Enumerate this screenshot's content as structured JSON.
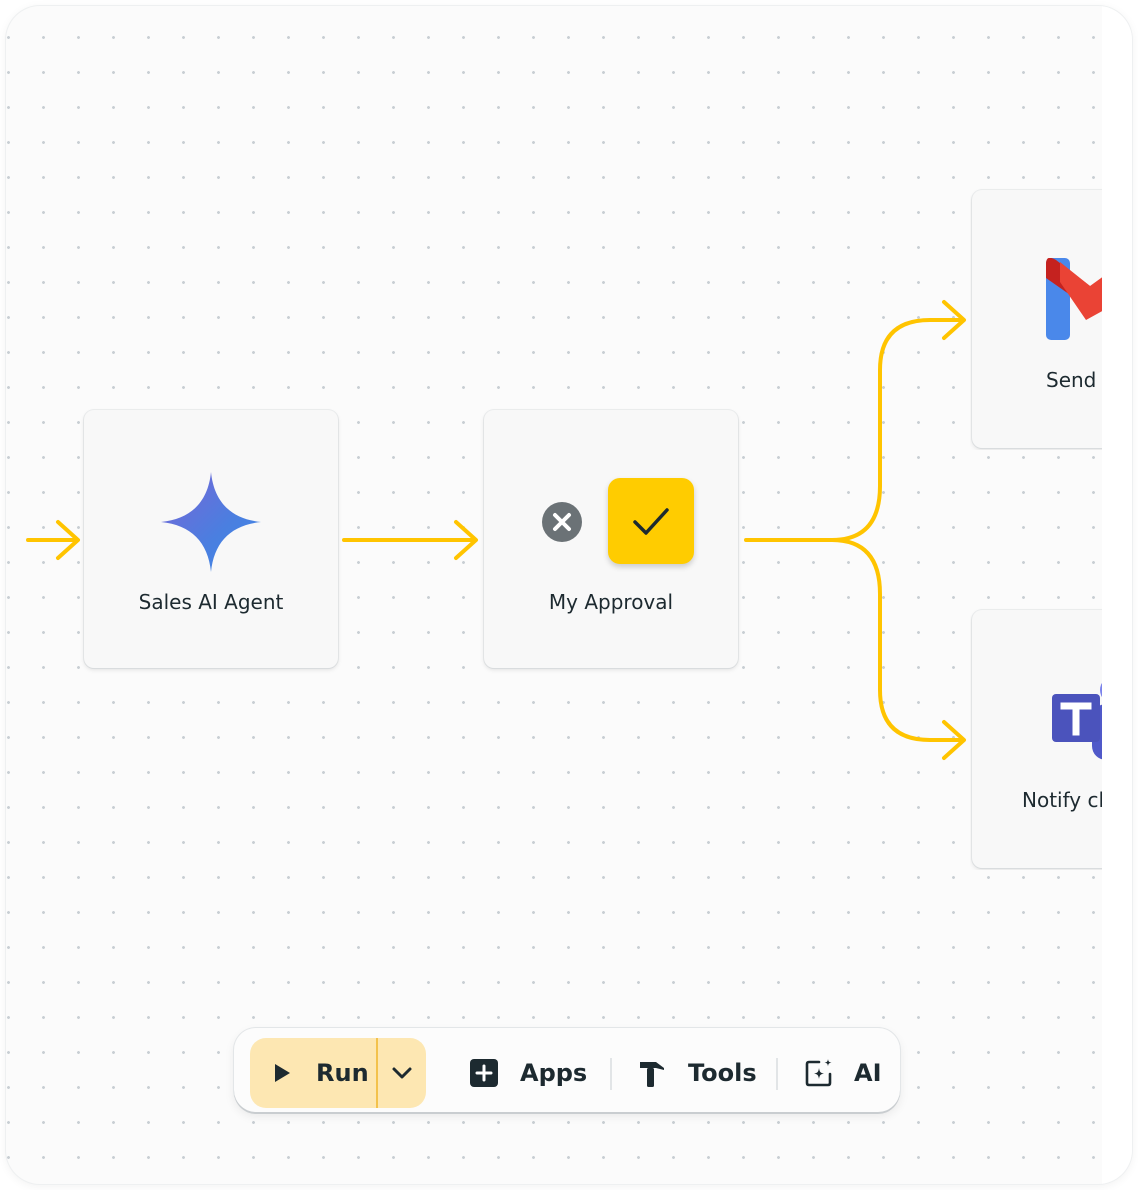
{
  "nodes": {
    "sales_agent": {
      "label": "Sales AI Agent",
      "icon": "sparkle-icon"
    },
    "approval": {
      "label": "My Approval",
      "reject_icon": "x-circle-icon",
      "approve_icon": "checkmark-icon"
    },
    "send_email": {
      "label": "Send e",
      "icon": "gmail-icon"
    },
    "notify": {
      "label": "Notify cl",
      "icon": "teams-icon"
    }
  },
  "toolbar": {
    "run_label": "Run",
    "apps_label": "Apps",
    "tools_label": "Tools",
    "ai_label": "AI"
  },
  "colors": {
    "connector": "#ffc400",
    "approve_bg": "#ffcc00",
    "run_bg": "#fde7b2",
    "text": "#1d2a30"
  }
}
